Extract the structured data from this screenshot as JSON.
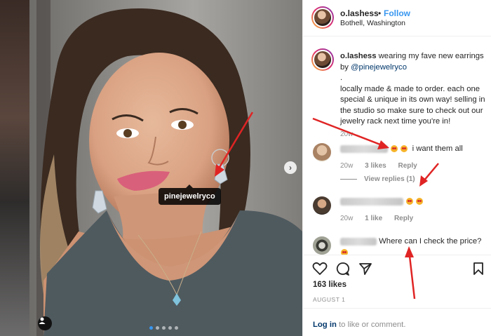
{
  "post": {
    "photo_alt": "woman wearing crystal earrings",
    "product_tag": "pinejewelryco",
    "carousel_dots": 5,
    "active_dot": 0
  },
  "header": {
    "username": "o.lashess",
    "separator": "•",
    "follow_label": "Follow",
    "location": "Bothell, Washington"
  },
  "caption": {
    "username": "o.lashess",
    "text_1": "wearing my fave new earrings by",
    "mention": "@pinejewelryco",
    "dot": ".",
    "text_2": "locally made & made to order. each one special & unique in its own way! selling in the studio so make sure to check out our jewelry rack next time you're in!",
    "time": "20w"
  },
  "comments": [
    {
      "text": "i want them all",
      "time": "20w",
      "likes": "3 likes",
      "reply": "Reply",
      "view_replies": "View replies (1)"
    },
    {
      "text": "",
      "time": "20w",
      "likes": "1 like",
      "reply": "Reply"
    },
    {
      "text": "Where can I check the price?"
    }
  ],
  "actions": {
    "icons": [
      "heart-icon",
      "comment-icon",
      "share-icon",
      "bookmark-icon"
    ],
    "likes": "163 likes",
    "date": "AUGUST 1",
    "login_link": "Log in",
    "login_rest": " to like or comment."
  },
  "colors": {
    "accent": "#3897f0",
    "annotation": "#e02424",
    "muted": "#8e8e8e"
  }
}
